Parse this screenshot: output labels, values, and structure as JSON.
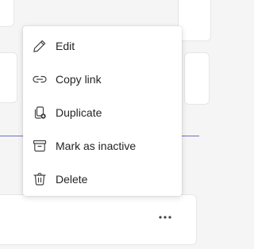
{
  "menu": {
    "items": [
      {
        "label": "Edit",
        "icon": "pencil-icon"
      },
      {
        "label": "Copy link",
        "icon": "link-icon"
      },
      {
        "label": "Duplicate",
        "icon": "duplicate-icon"
      },
      {
        "label": "Mark as inactive",
        "icon": "archive-icon"
      },
      {
        "label": "Delete",
        "icon": "trash-icon"
      }
    ]
  },
  "card": {
    "more_icon": "more-horizontal-icon"
  },
  "colors": {
    "text": "#242424",
    "icon": "#424242",
    "divider": "#6b6fc7",
    "background": "#f5f5f5",
    "surface": "#ffffff"
  }
}
